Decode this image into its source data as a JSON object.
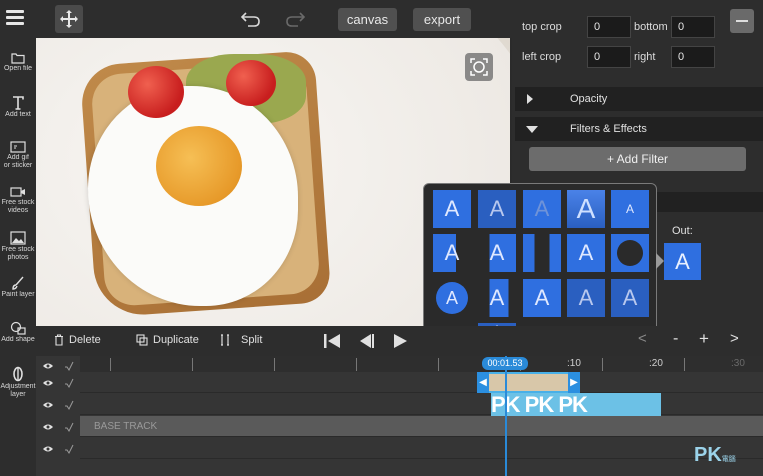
{
  "toolbar": {
    "canvas_label": "canvas",
    "export_label": "export"
  },
  "sidebar": {
    "items": [
      {
        "label": "Open file",
        "icon": "folder-icon"
      },
      {
        "label": "Add text",
        "icon": "text-icon"
      },
      {
        "label": "Add gif\nor sticker",
        "icon": "gif-icon"
      },
      {
        "label": "Free stock\nvideos",
        "icon": "video-camera-icon"
      },
      {
        "label": "Free stock\nphotos",
        "icon": "photo-icon"
      },
      {
        "label": "Paint layer",
        "icon": "brush-icon"
      },
      {
        "label": "Add shape",
        "icon": "shape-icon"
      },
      {
        "label": "Adjustment\nlayer",
        "icon": "adjustment-icon"
      }
    ]
  },
  "crop": {
    "top_label": "top crop",
    "top_value": "0",
    "bottom_label": "bottom",
    "bottom_value": "0",
    "left_label": "left crop",
    "left_value": "0",
    "right_label": "right",
    "right_value": "0"
  },
  "panel": {
    "opacity_label": "Opacity",
    "filters_label": "Filters & Effects",
    "add_filter_label": "+ Add Filter",
    "out_label": "Out:",
    "tile_glyph": "A"
  },
  "timeline": {
    "delete_label": "Delete",
    "duplicate_label": "Duplicate",
    "split_label": "Split",
    "time_bubble": "00:01.53",
    "ticks": [
      ":10",
      ":20",
      ":30"
    ],
    "base_track_label": "BASE TRACK",
    "clip_text": "PK PK PK",
    "zoom_minus": "-",
    "zoom_plus": "+",
    "zoom_more": ">",
    "zoom_less": "<"
  },
  "watermark": {
    "brand": "PK",
    "sub": "電腦"
  },
  "colors": {
    "accent": "#2f6fe0",
    "playhead": "#2a8ad8",
    "panel": "#2d2d2d"
  }
}
